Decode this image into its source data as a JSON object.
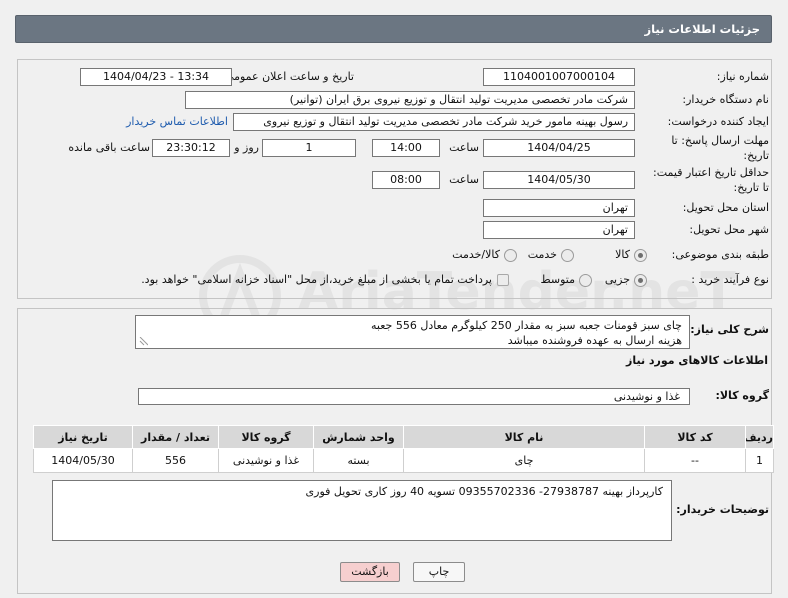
{
  "theme": {
    "header_bg": "#6b7682",
    "link_color": "#1f5cae",
    "back_button_bg": "#f6cfcf",
    "print_button_bg": "#f7f7f7",
    "table_header_bg": "#d8d8d8"
  },
  "watermark": {
    "text": "AriaTender.neT"
  },
  "header": {
    "title": "جزئیات اطلاعات نیاز"
  },
  "fields": {
    "need_number": {
      "label": "شماره نیاز:",
      "value": "1104001007000104"
    },
    "announce_datetime": {
      "label": "تاریخ و ساعت اعلان عمومی:",
      "value": "1404/04/23 - 13:34"
    },
    "buyer_org": {
      "label": "نام دستگاه خریدار:",
      "value": "شرکت مادر تخصصی مدیریت تولید  انتقال و توزیع نیروی برق ایران (توانیر)"
    },
    "requester": {
      "label": "ایجاد کننده درخواست:",
      "value": "رسول بهینه مامور خرید شرکت مادر تخصصی مدیریت تولید  انتقال و توزیع نیروی",
      "contact_link": "اطلاعات تماس خریدار"
    },
    "response_deadline": {
      "label_line1": "مهلت ارسال پاسخ: تا",
      "label_line2": "تاریخ:",
      "date": "1404/04/25",
      "time_label": "ساعت",
      "time": "14:00",
      "days": "1",
      "days_label": "روز و",
      "remaining": "23:30:12",
      "remaining_label": "ساعت باقی مانده"
    },
    "price_validity": {
      "label_line1": "حداقل تاریخ اعتبار قیمت:",
      "label_line2": "تا تاریخ:",
      "date": "1404/05/30",
      "time_label": "ساعت",
      "time": "08:00"
    },
    "delivery_province": {
      "label": "استان محل تحویل:",
      "value": "تهران"
    },
    "delivery_city": {
      "label": "شهر محل تحویل:",
      "value": "تهران"
    },
    "category": {
      "label": "طبقه بندی موضوعی:",
      "options": [
        {
          "label": "کالا",
          "selected": true
        },
        {
          "label": "خدمت",
          "selected": false
        },
        {
          "label": "کالا/خدمت",
          "selected": false
        }
      ]
    },
    "process_type": {
      "label": "نوع فرآیند خرید :",
      "options": [
        {
          "label": "جزیی",
          "selected": true
        },
        {
          "label": "متوسط",
          "selected": false
        }
      ],
      "treasury_bonds": {
        "label": "پرداخت تمام یا بخشی از مبلغ خرید،از محل \"اسناد خزانه اسلامی\" خواهد بود.",
        "checked": false
      }
    }
  },
  "description": {
    "label": "شرح کلی نیاز:",
    "lines": [
      "چای سبز قومنات جعبه سبز به مقدار 250 کیلوگرم معادل 556 جعبه",
      "هزینه ارسال به عهده فروشنده میباشد"
    ]
  },
  "goods": {
    "heading": "اطلاعات کالاهای مورد نیاز",
    "group_label": "گروه کالا:",
    "group_value": "غذا و نوشیدنی",
    "table": {
      "columns": [
        "ردیف",
        "کد کالا",
        "نام کالا",
        "واحد شمارش",
        "گروه کالا",
        "تعداد / مقدار",
        "تاریخ نیاز"
      ],
      "rows": [
        [
          "1",
          "--",
          "چای",
          "بسته",
          "غذا و نوشیدنی",
          "556",
          "1404/05/30"
        ]
      ]
    }
  },
  "buyer_notes": {
    "label": "توضیحات خریدار:",
    "text": "کارپرداز بهینه 27938787- 09355702336   تسویه 40 روز کاری  تحویل فوری"
  },
  "buttons": {
    "print": "چاپ",
    "back": "بازگشت"
  }
}
